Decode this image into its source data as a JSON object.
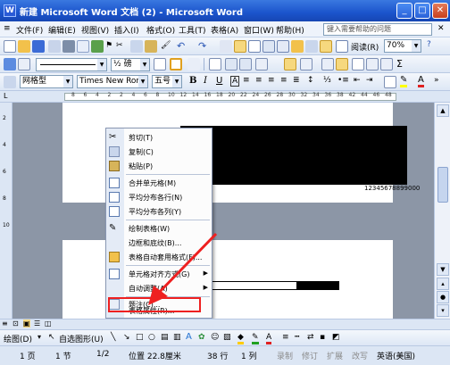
{
  "window": {
    "title": "新建 Microsoft Word 文档 (2) - Microsoft Word",
    "app_icon": "W"
  },
  "menubar": {
    "items": [
      "文件(F)",
      "编辑(E)",
      "视图(V)",
      "插入(I)",
      "格式(O)",
      "工具(T)",
      "表格(A)",
      "窗口(W)",
      "帮助(H)"
    ],
    "help_placeholder": "键入需要帮助的问题"
  },
  "toolbar_std": {
    "read_label": "阅读(R)",
    "zoom": "70%"
  },
  "toolbar_fmt": {
    "border_weight": "½ 磅"
  },
  "toolbar_font": {
    "style": "网格型",
    "font": "Times New Roman",
    "size": "五号"
  },
  "ruler": {
    "marks": [
      "8",
      "6",
      "4",
      "2",
      "2",
      "4",
      "6",
      "8",
      "10",
      "12",
      "14",
      "16",
      "18",
      "20",
      "22",
      "24",
      "26",
      "28",
      "30",
      "32",
      "34",
      "36",
      "38",
      "42",
      "44",
      "46",
      "48"
    ]
  },
  "vruler": {
    "marks": [
      "2",
      "4",
      "6",
      "8",
      "10"
    ]
  },
  "document": {
    "cell_text": "12345678899000"
  },
  "context_menu": {
    "items": [
      {
        "label": "剪切(T)",
        "icon": "scissors-icon"
      },
      {
        "label": "复制(C)",
        "icon": "copy-icon"
      },
      {
        "label": "粘贴(P)",
        "icon": "paste-icon"
      },
      {
        "label": "合并单元格(M)",
        "icon": "merge-cells-icon"
      },
      {
        "label": "平均分布各行(N)",
        "icon": "distribute-rows-icon"
      },
      {
        "label": "平均分布各列(Y)",
        "icon": "distribute-columns-icon"
      },
      {
        "label": "绘制表格(W)",
        "icon": "draw-table-icon"
      },
      {
        "label": "边框和底纹(B)...",
        "icon": ""
      },
      {
        "label": "表格自动套用格式(F)...",
        "icon": "table-autoformat-icon"
      },
      {
        "label": "单元格对齐方式(G)",
        "icon": "cell-align-icon"
      },
      {
        "label": "自动调整(A)",
        "icon": ""
      },
      {
        "label": "题注(C)...",
        "icon": "caption-icon"
      },
      {
        "label": "表格属性(R)...",
        "icon": ""
      }
    ]
  },
  "drawbar": {
    "draw_label": "绘图(D)",
    "autoshape_label": "自选图形(U)"
  },
  "statusbar": {
    "page": "1 页",
    "section": "1 节",
    "pages": "1/2",
    "position": "位置 22.8厘米",
    "line": "38 行",
    "column": "1 列",
    "rec": "录制",
    "trk": "修订",
    "ext": "扩展",
    "ovr": "改写",
    "lang": "英语(美国)"
  },
  "colors": {
    "titlebar": "#1b54cc",
    "highlight": "#ee2020",
    "doc_bg": "#8c96a6"
  }
}
